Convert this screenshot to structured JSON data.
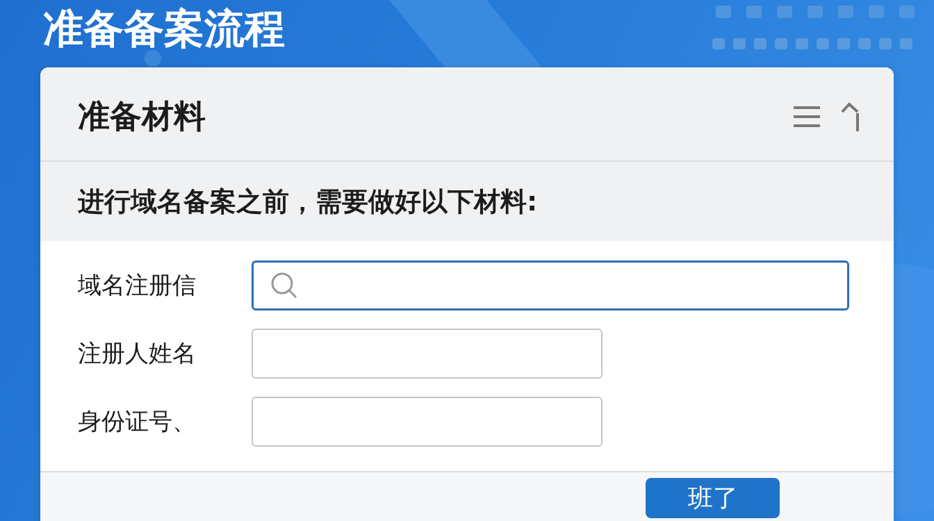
{
  "page_title": "准备备案流程",
  "panel": {
    "title": "准备材料",
    "subtitle": "进行域名备案之前，需要做好以下材料:",
    "fields": [
      {
        "label": "域名注册信",
        "kind": "search",
        "focused": true
      },
      {
        "label": "注册人姓名",
        "kind": "text",
        "focused": false
      },
      {
        "label": "身份证号、",
        "kind": "text",
        "focused": false
      }
    ],
    "button": "班了"
  }
}
